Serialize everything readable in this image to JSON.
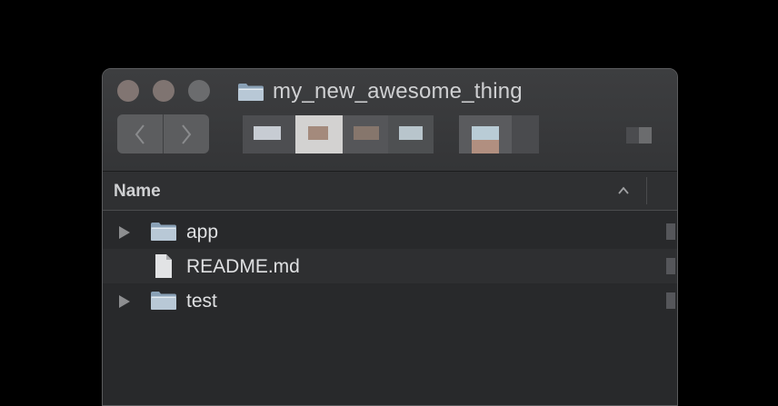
{
  "window": {
    "title": "my_new_awesome_thing"
  },
  "toolbar": {
    "back_icon": "chevron-left",
    "forward_icon": "chevron-right"
  },
  "columns": {
    "name_header": "Name",
    "sort_icon": "chevron-up"
  },
  "files": [
    {
      "name": "app",
      "type": "folder",
      "expandable": true
    },
    {
      "name": "README.md",
      "type": "file",
      "expandable": false
    },
    {
      "name": "test",
      "type": "folder",
      "expandable": true
    }
  ],
  "colors": {
    "background": "#000000",
    "window": "#28292b",
    "titlebar": "#3a3b3d",
    "text": "#dfe0e2",
    "folder": "#8fa3b5"
  }
}
